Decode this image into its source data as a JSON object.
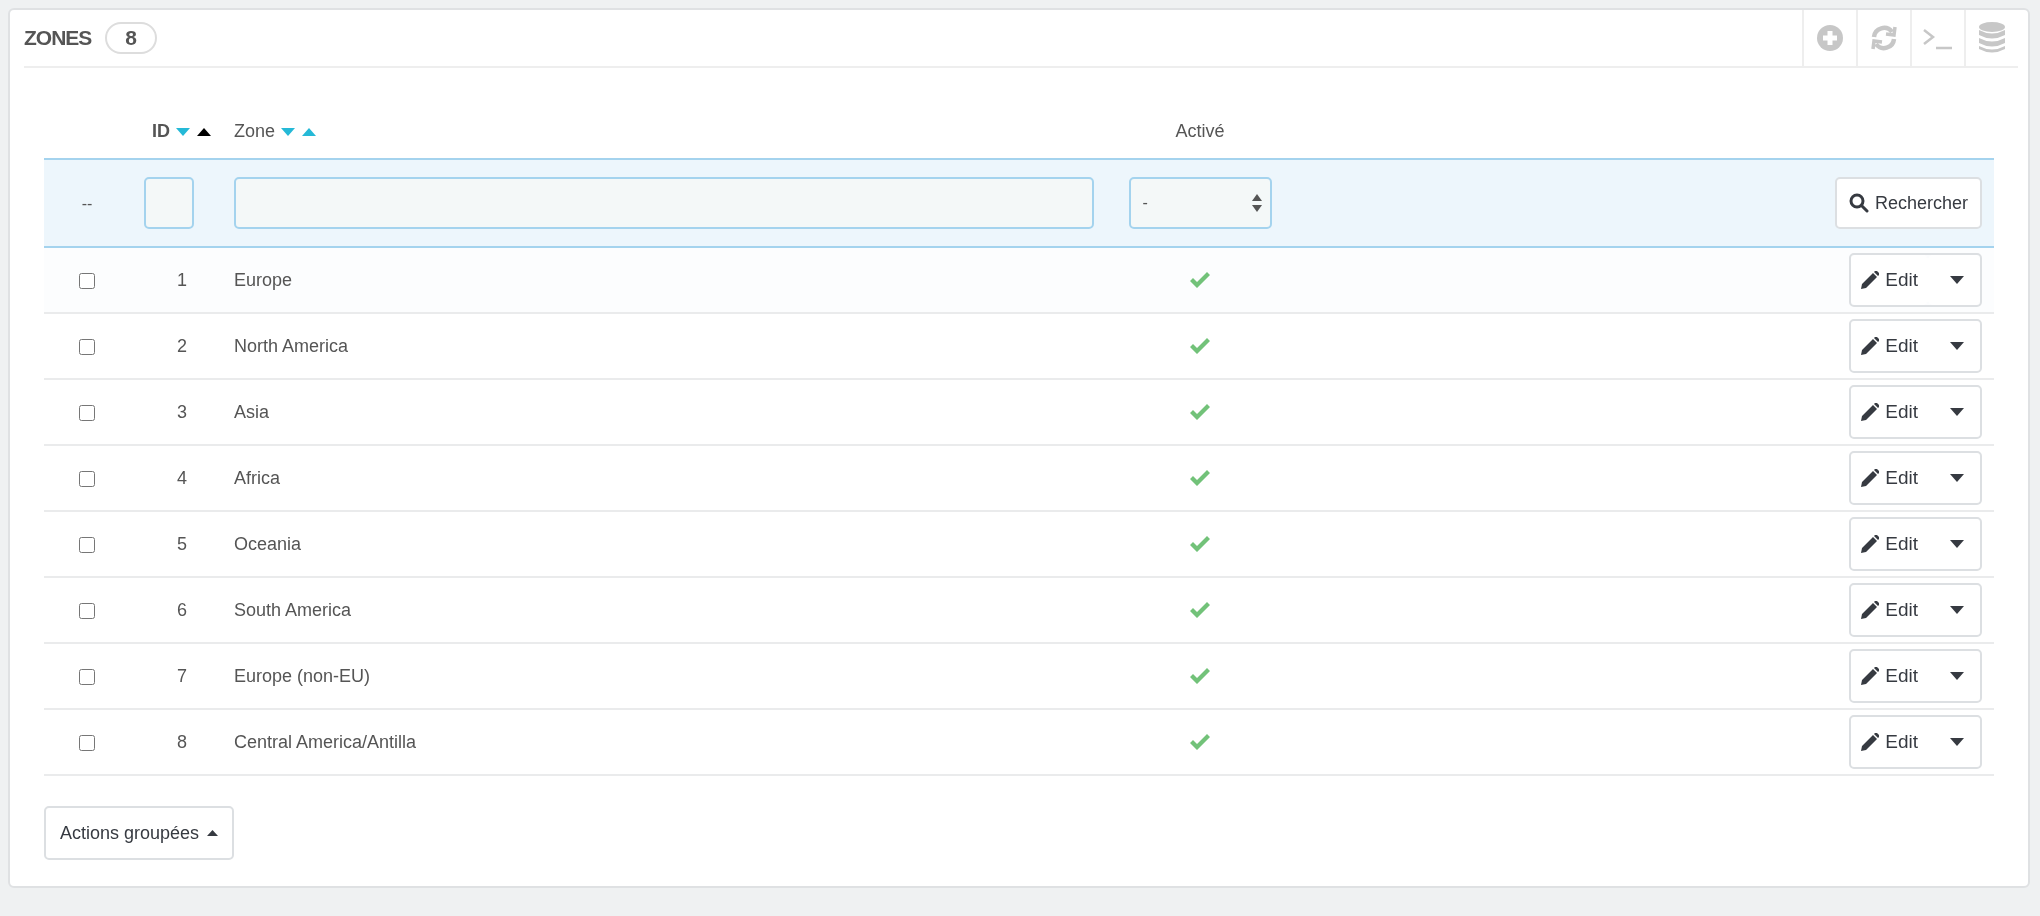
{
  "panel": {
    "title": "ZONES",
    "count": "8",
    "toolbar": [
      {
        "kind": "add"
      },
      {
        "kind": "refresh"
      },
      {
        "kind": "sql"
      },
      {
        "kind": "export"
      }
    ]
  },
  "columns": [
    {
      "label": "ID",
      "sort": {
        "down_selected": false,
        "up_selected": true
      }
    },
    {
      "label": "Zone",
      "sort": {
        "down_selected": false,
        "up_selected": false
      }
    },
    {
      "label": "Activé"
    }
  ],
  "filters": {
    "select_all": "--",
    "active_value": "-",
    "search_button": "Rechercher"
  },
  "rows": [
    {
      "checked": false,
      "id": "1",
      "zone": "Europe",
      "active": true,
      "action": "Edit"
    },
    {
      "checked": false,
      "id": "2",
      "zone": "North America",
      "active": true,
      "action": "Edit"
    },
    {
      "checked": false,
      "id": "3",
      "zone": "Asia",
      "active": true,
      "action": "Edit"
    },
    {
      "checked": false,
      "id": "4",
      "zone": "Africa",
      "active": true,
      "action": "Edit"
    },
    {
      "checked": false,
      "id": "5",
      "zone": "Oceania",
      "active": true,
      "action": "Edit"
    },
    {
      "checked": false,
      "id": "6",
      "zone": "South America",
      "active": true,
      "action": "Edit"
    },
    {
      "checked": false,
      "id": "7",
      "zone": "Europe (non-EU)",
      "active": true,
      "action": "Edit"
    },
    {
      "checked": false,
      "id": "8",
      "zone": "Central America/Antilla",
      "active": true,
      "action": "Edit"
    }
  ],
  "bulk_actions": "Actions groupées"
}
